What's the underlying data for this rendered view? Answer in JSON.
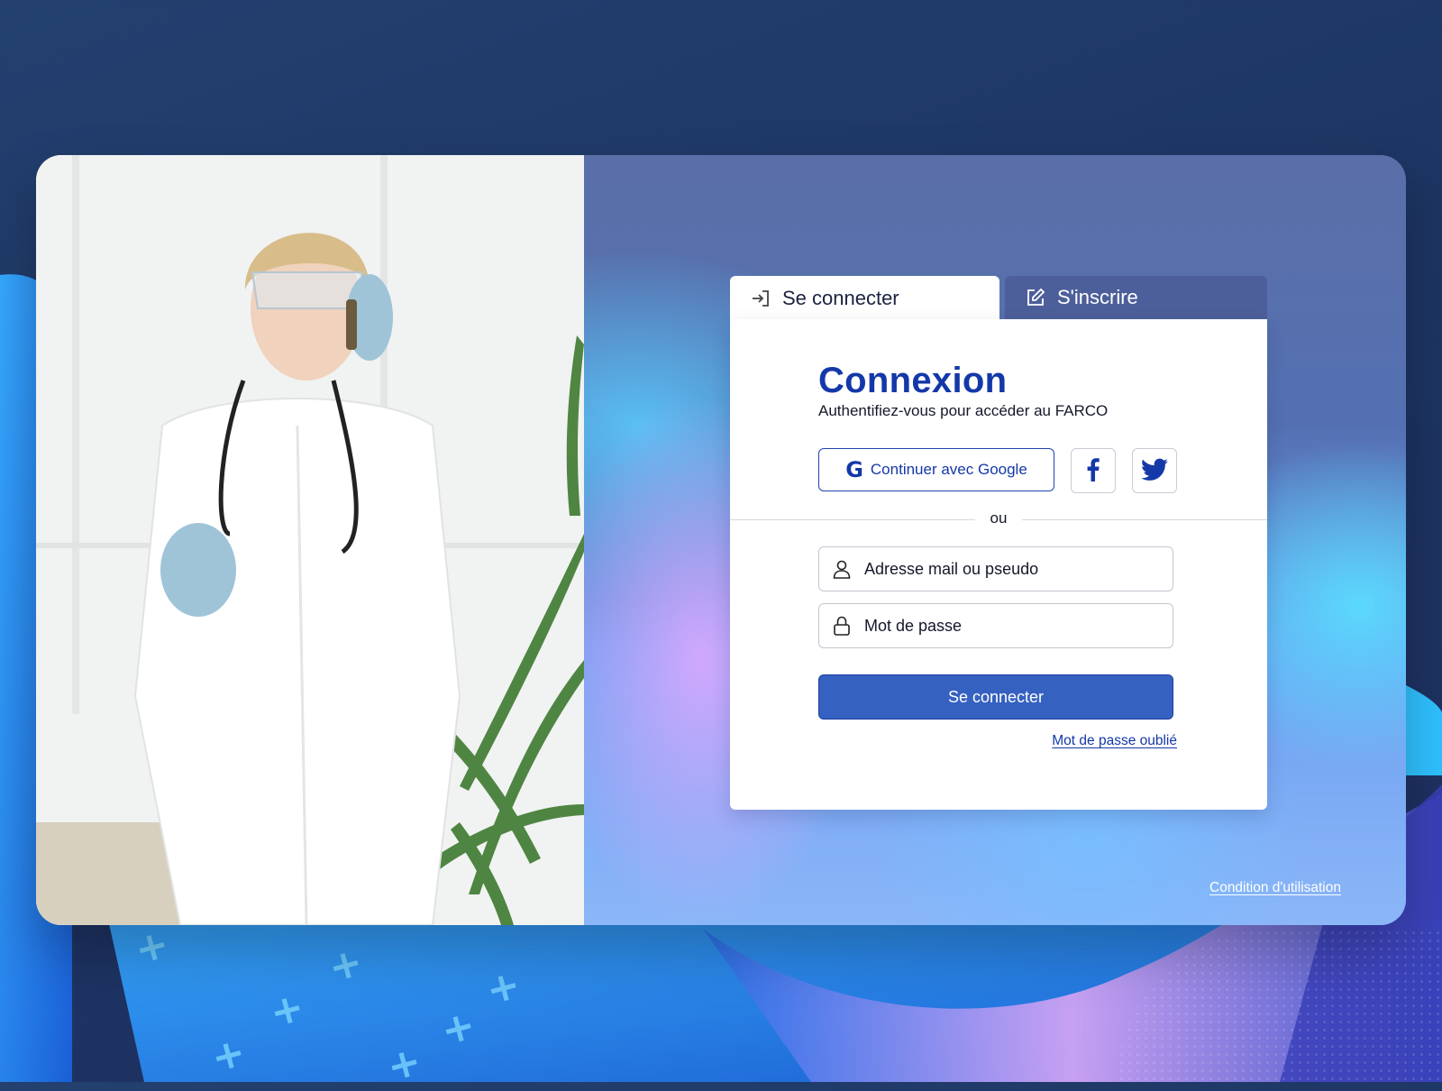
{
  "tabs": {
    "login_label": "Se connecter",
    "register_label": "S'inscrire",
    "login_icon": "sign-in-icon",
    "register_icon": "edit-icon"
  },
  "login": {
    "title": "Connexion",
    "subtitle": "Authentifiez-vous pour accéder au FARCO",
    "google_label": "Continuer avec Google",
    "google_icon": "google-icon",
    "facebook_icon": "facebook-icon",
    "twitter_icon": "twitter-icon",
    "divider_label": "ou",
    "email_placeholder": "Adresse mail ou pseudo",
    "password_placeholder": "Mot de passe",
    "submit_label": "Se connecter",
    "forgot_label": "Mot de passe oublié"
  },
  "footer": {
    "terms_label": "Condition d'utilisation"
  },
  "colors": {
    "brand_blue": "#1438a8",
    "submit_blue": "#3561c1",
    "page_background": "#1d3563"
  }
}
